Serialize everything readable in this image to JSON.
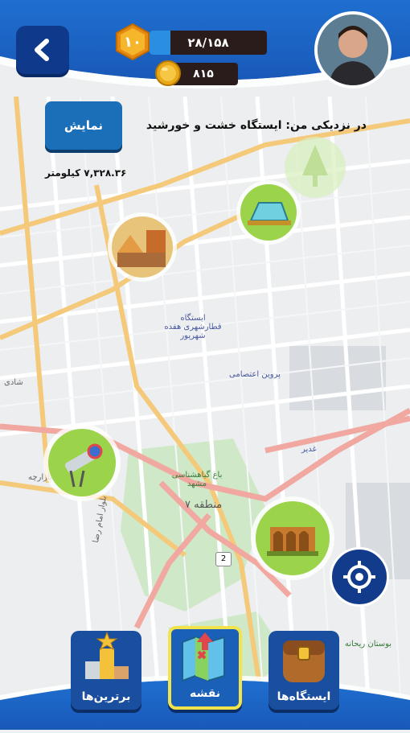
{
  "header": {
    "level": "۱۰",
    "xp_text": "۲۸/۱۵۸",
    "xp_progress": 0.18,
    "coins": "۸۱۵"
  },
  "nearby": {
    "label": "در نزدیکی من: ایستگاه خشت و خورشید",
    "show_button": "نمایش",
    "distance": "۷,۳۲۸.۳۶ کیلومتر"
  },
  "map_labels": {
    "station": "ایستگاه قطارشهری هفده شهریور",
    "parvin": "پروین اعتصامی",
    "garden": "باغ گیاهشناسی مشهد",
    "region7": "منطقه ۷",
    "park": "بوستان ریحانه",
    "ghadir": "غدیر",
    "shadi": "شادی",
    "bazaar": "بازارچه",
    "emam_reza": "بلوار امام رضا",
    "road_2": "2"
  },
  "nav": {
    "stations_label": "ایستگاه‌ها",
    "map_label": "نقشه",
    "leaders_label": "برترین‌ها"
  },
  "colors": {
    "primary_blue": "#1a4fa0",
    "active_outline": "#f2e34a",
    "marker_green": "#8dc63f"
  }
}
